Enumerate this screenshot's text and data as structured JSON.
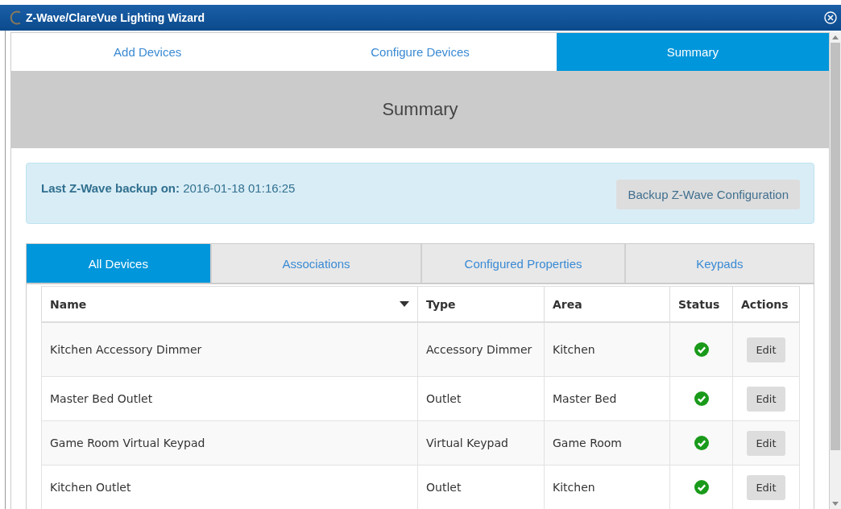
{
  "window": {
    "title": "Z-Wave/ClareVue Lighting Wizard"
  },
  "tabs": [
    {
      "label": "Add Devices",
      "selected": false
    },
    {
      "label": "Configure Devices",
      "selected": false
    },
    {
      "label": "Summary",
      "selected": true
    }
  ],
  "heading": "Summary",
  "backup": {
    "label": "Last Z-Wave backup on:",
    "value": "2016-01-18 01:16:25",
    "button": "Backup Z-Wave Configuration"
  },
  "subtabs": [
    {
      "label": "All Devices",
      "selected": true
    },
    {
      "label": "Associations",
      "selected": false
    },
    {
      "label": "Configured Properties",
      "selected": false
    },
    {
      "label": "Keypads",
      "selected": false
    }
  ],
  "table": {
    "columns": [
      "Name",
      "Type",
      "Area",
      "Status",
      "Actions"
    ],
    "rows": [
      {
        "name": "Kitchen Accessory Dimmer",
        "type": "Accessory Dimmer",
        "area": "Kitchen",
        "ok": true,
        "action": "Edit"
      },
      {
        "name": "Master Bed Outlet",
        "type": "Outlet",
        "area": "Master Bed",
        "ok": true,
        "action": "Edit"
      },
      {
        "name": "Game Room Virtual Keypad",
        "type": "Virtual Keypad",
        "area": "Game Room",
        "ok": true,
        "action": "Edit"
      },
      {
        "name": "Kitchen Outlet",
        "type": "Outlet",
        "area": "Kitchen",
        "ok": true,
        "action": "Edit"
      }
    ]
  }
}
